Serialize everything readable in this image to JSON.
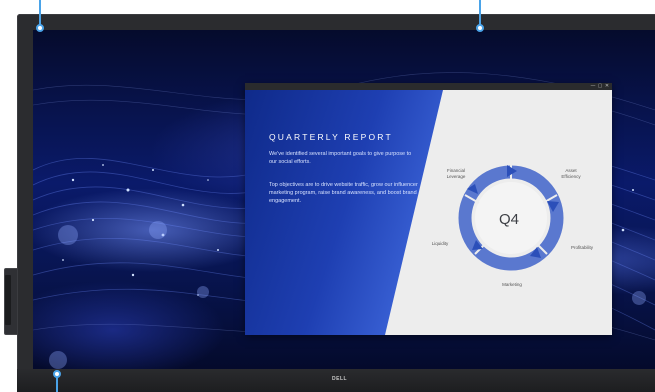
{
  "device": {
    "brand_logo": "DELL"
  },
  "app_window": {
    "controls": [
      "—",
      "▢",
      "✕"
    ]
  },
  "slide": {
    "title": "QUARTERLY REPORT",
    "paragraphs": [
      "We've identified several important goals to give purpose to our social efforts.",
      "Top objectives are to drive website traffic, grow our influencer marketing program, raise brand awareness, and boost brand engagement."
    ],
    "cycle": {
      "center": "Q4",
      "labels": [
        "Financial Leverage",
        "Asset Efficiency",
        "Profitability",
        "Marketing",
        "Liquidity"
      ]
    }
  },
  "colors": {
    "callout": "#4aa3e8",
    "slide_blue_dark": "#0f2a8a",
    "slide_blue_light": "#3a62d6",
    "cycle_arrow": "#3f63c9"
  }
}
